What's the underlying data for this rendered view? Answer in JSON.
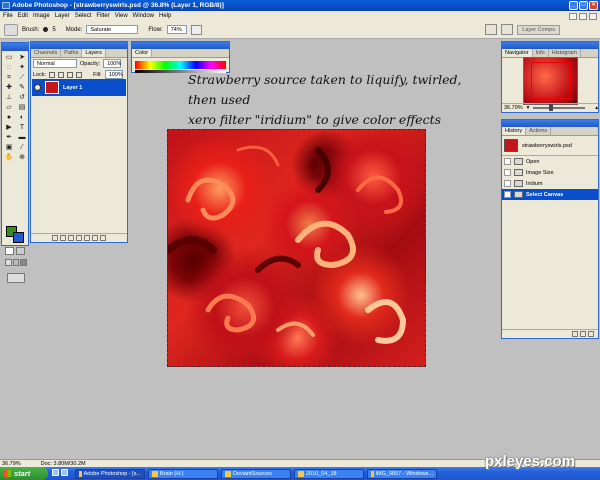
{
  "window": {
    "title": "Adobe Photoshop - [strawberryswirls.psd @ 36.8% (Layer 1, RGB/8)]"
  },
  "menu": [
    "File",
    "Edit",
    "Image",
    "Layer",
    "Select",
    "Filter",
    "View",
    "Window",
    "Help"
  ],
  "options": {
    "brush_label": "Brush:",
    "brush_size": "5",
    "mode_label": "Mode:",
    "mode_value": "Saturate",
    "flow_label": "Flow:",
    "flow_value": "74%",
    "layer_comps": "Layer Comps"
  },
  "layers_panel": {
    "tabs": [
      "Channels",
      "Paths",
      "Layers"
    ],
    "blend_mode": "Normal",
    "opacity_label": "Opacity:",
    "opacity_value": "100%",
    "lock_label": "Lock:",
    "fill_label": "Fill:",
    "fill_value": "100%",
    "layer_name": "Layer 1"
  },
  "color_panel": {
    "tab": "Color"
  },
  "caption": {
    "line1": "Strawberry source taken to liquify, twirled, then used",
    "line2": "xero filter \"iridium\" to give color effects"
  },
  "navigator": {
    "tabs": [
      "Navigator",
      "Info",
      "Histogram"
    ],
    "zoom": "36.79%"
  },
  "history": {
    "tabs": [
      "History",
      "Actions"
    ],
    "snapshot": "strawberryswirls.psd",
    "items": [
      "Open",
      "Image Size",
      "Iridium",
      "Select Canvas"
    ]
  },
  "status": {
    "zoom": "36.79%",
    "doc": "Doc: 3.80M/30.2M"
  },
  "taskbar": {
    "start": "start",
    "buttons": [
      "Adobe Photoshop - [s...",
      "Brain (H:)",
      "DeviantSources",
      "2010_04_18",
      "IMG_0857 - Windows..."
    ]
  },
  "watermark": "pxleyes.com"
}
